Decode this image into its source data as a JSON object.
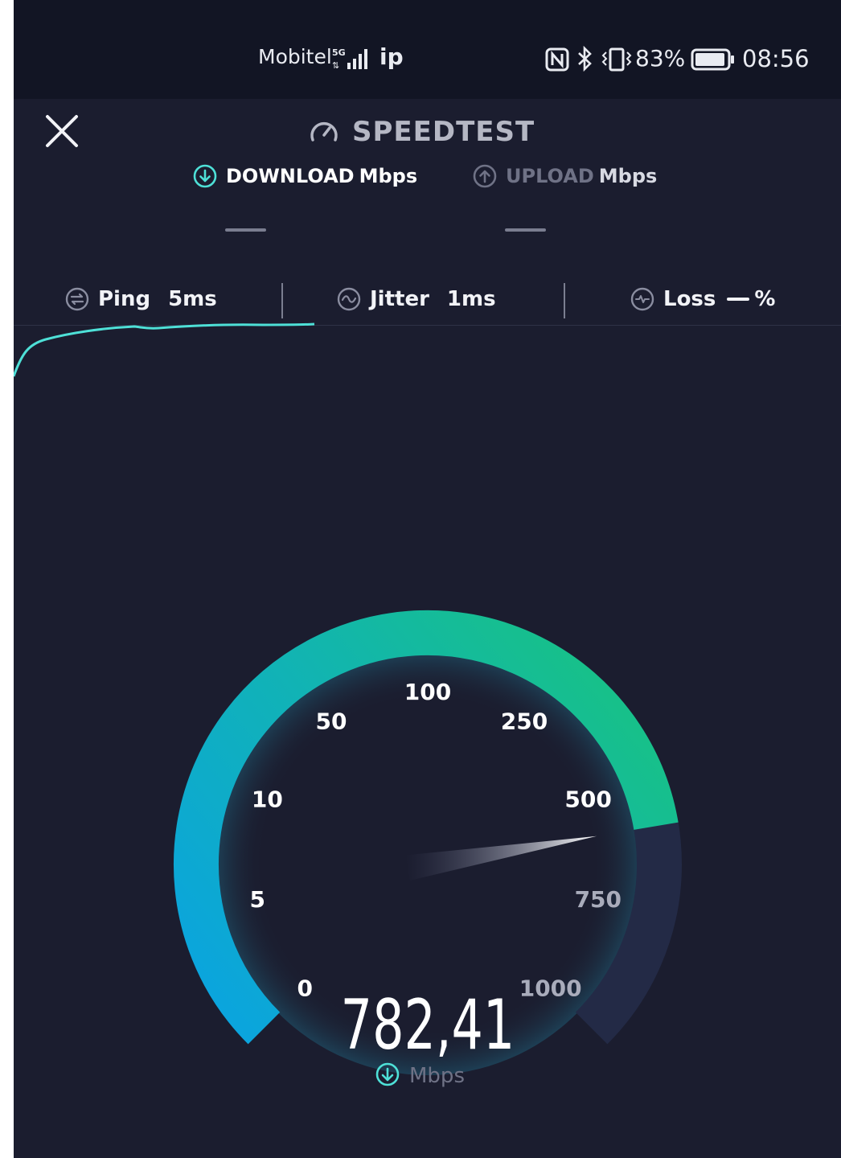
{
  "status_bar": {
    "carrier": "Mobitel",
    "network_badge": "5G",
    "network_label": "ip",
    "battery_percent": "83%",
    "time": "08:56",
    "icons": [
      "nfc-icon",
      "bluetooth-icon",
      "vibrate-icon",
      "battery-icon",
      "signal-icon"
    ]
  },
  "header": {
    "title": "SPEEDTEST",
    "close_icon": "close-icon",
    "title_icon": "speedometer-icon"
  },
  "tabs": {
    "download": {
      "label": "DOWNLOAD",
      "unit": "Mbps",
      "icon": "download-arrow-icon",
      "active": true
    },
    "upload": {
      "label": "UPLOAD",
      "unit": "Mbps",
      "icon": "upload-arrow-icon",
      "active": false
    }
  },
  "metrics": {
    "ping": {
      "label": "Ping",
      "value": "5ms",
      "icon": "ping-icon"
    },
    "jitter": {
      "label": "Jitter",
      "value": "1ms",
      "icon": "jitter-icon"
    },
    "loss": {
      "label": "Loss",
      "value": "%",
      "icon": "loss-icon"
    }
  },
  "gauge": {
    "ticks": [
      "0",
      "5",
      "10",
      "50",
      "100",
      "250",
      "500",
      "750",
      "1000"
    ],
    "reading": "782,41",
    "unit": "Mbps",
    "progress": 0.78241,
    "colors": {
      "start": "#0aa3e2",
      "mid": "#11b3b5",
      "end": "#17c08a",
      "track": "#232a46",
      "accent": "#4ee0d7"
    }
  }
}
